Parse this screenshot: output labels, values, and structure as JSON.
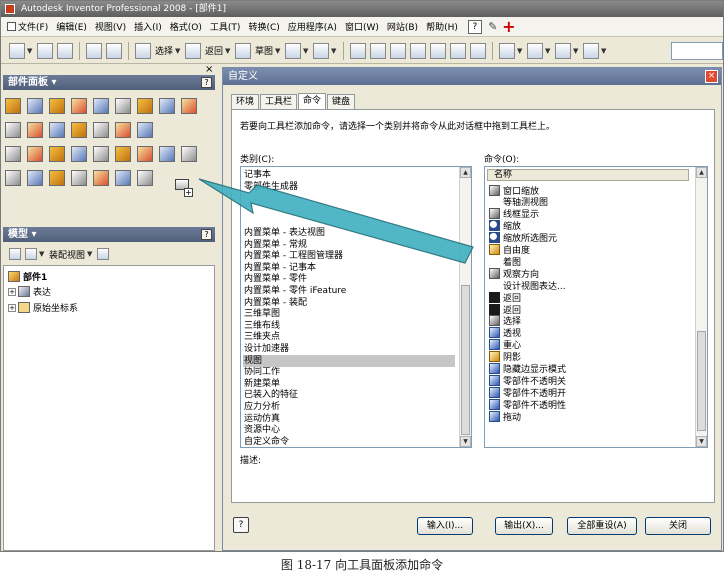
{
  "window": {
    "title": "Autodesk Inventor Professional 2008 - [部件1]"
  },
  "menubar": {
    "items": [
      "文件(F)",
      "编辑(E)",
      "视图(V)",
      "插入(I)",
      "格式(O)",
      "工具(T)",
      "转换(C)",
      "应用程序(A)",
      "窗口(W)",
      "网站(B)",
      "帮助(H)"
    ],
    "help_glyph": "?"
  },
  "toolbar": {
    "select_label": "选择",
    "return_label": "返回",
    "sketch_label": "草图"
  },
  "parts_panel": {
    "title": "部件面板",
    "dropdown_glyph": "▾",
    "help_glyph": "?",
    "close_glyph": "×"
  },
  "model_panel": {
    "title": "模型",
    "dropdown_glyph": "▾",
    "help_glyph": "?",
    "view_label": "装配视图",
    "tree": [
      {
        "label": "部件1"
      },
      {
        "label": "表达",
        "expander": "+"
      },
      {
        "label": "原始坐标系",
        "expander": "+"
      }
    ]
  },
  "dialog": {
    "title": "自定义",
    "close_glyph": "×",
    "tabs": [
      "环境",
      "工具栏",
      "命令",
      "键盘"
    ],
    "instruction": "若要向工具栏添加命令，请选择一个类别并将命令从此对话框中拖到工具栏上。",
    "category_label": "类别(C):",
    "commands_label": "命令(O):",
    "commands_header": "名称",
    "description_label": "描述:",
    "categories": [
      "记事本",
      "零部件生成器",
      "",
      "",
      "",
      "内置菜单 - 表达视图",
      "内置菜单 - 常规",
      "内置菜单 - 工程图管理器",
      "内置菜单 - 记事本",
      "内置菜单 - 零件",
      "内置菜单 - 零件 iFeature",
      "内置菜单 - 装配",
      "三维草图",
      "三维布线",
      "三维夹点",
      "设计加速器",
      "视图",
      "协同工作",
      "新建菜单",
      "已装入的特征",
      "应力分析",
      "运动仿真",
      "资源中心",
      "自定义命令"
    ],
    "selected_category": "视图",
    "commands": [
      {
        "icon": "zoom-window-icon",
        "label": "窗口缩放"
      },
      {
        "icon": "blank",
        "label": "等轴测视图"
      },
      {
        "icon": "frame-display-icon",
        "label": "线框显示"
      },
      {
        "icon": "zoom-icon",
        "label": "缩放"
      },
      {
        "icon": "zoom-selected-icon",
        "label": "缩放所选图元"
      },
      {
        "icon": "orbit-icon",
        "label": "自由度"
      },
      {
        "icon": "blank",
        "label": "着图"
      },
      {
        "icon": "view-direction-icon",
        "label": "观察方向"
      },
      {
        "icon": "blank",
        "label": "设计视图表达..."
      },
      {
        "icon": "back-icon",
        "label": "返回"
      },
      {
        "icon": "back-icon",
        "label": "返回"
      },
      {
        "icon": "select-icon",
        "label": "选择"
      },
      {
        "icon": "perspective-icon",
        "label": "透视"
      },
      {
        "icon": "center-icon",
        "label": "重心"
      },
      {
        "icon": "shadow-icon",
        "label": "阴影"
      },
      {
        "icon": "hidden-edge-icon",
        "label": "隐藏边显示模式"
      },
      {
        "icon": "component-opacity-icon",
        "label": "零部件不透明关"
      },
      {
        "icon": "component-opacity-icon",
        "label": "零部件不透明开"
      },
      {
        "icon": "component-opacity-icon",
        "label": "零部件不透明性"
      },
      {
        "icon": "drag-icon",
        "label": "拖动"
      }
    ],
    "buttons": {
      "help": "?",
      "import": "输入(I)...",
      "export": "输出(X)...",
      "reset_all": "全部重设(A)",
      "close": "关闭"
    }
  },
  "caption": "图 18-17  向工具面板添加命令",
  "colors": {
    "arrow": "#3fb0c0",
    "arrow_outline": "#1f6d78",
    "selection": "#c6c6c6"
  }
}
